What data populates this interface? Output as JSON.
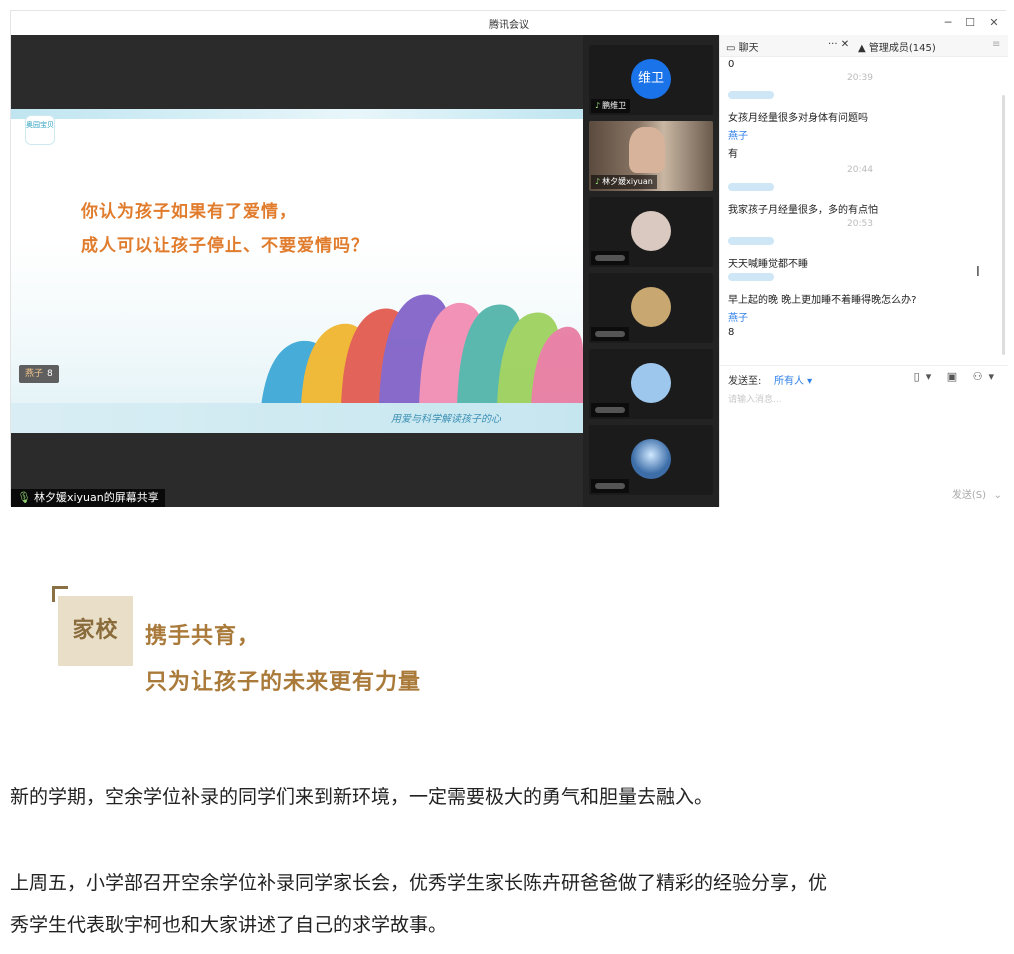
{
  "window": {
    "title": "腾讯会议",
    "controls": {
      "minimize": "─",
      "maximize": "☐",
      "close": "✕"
    }
  },
  "slide": {
    "logo_text": "奥园宝贝",
    "question_line1": "你认为孩子如果有了爱情，",
    "question_line2": "成人可以让孩子停止、不要爱情吗？",
    "chip_name": "燕子",
    "chip_value": "8",
    "bottom_tag": "用爱与科学解读孩子的心"
  },
  "share_label": "林夕媛xiyuan的屏幕共享",
  "participants": [
    {
      "name": "鹏维卫",
      "avatar_text": "维卫",
      "avatar_color": "#1a73e8"
    },
    {
      "name": "林夕媛xiyuan",
      "avatar_text": "",
      "avatar_color": "#7b6a5a"
    },
    {
      "name": "",
      "avatar_text": "",
      "avatar_color": "#d9c9c0"
    },
    {
      "name": "",
      "avatar_text": "",
      "avatar_color": "#c8a770"
    },
    {
      "name": "",
      "avatar_text": "",
      "avatar_color": "#9ec7ee"
    },
    {
      "name": "",
      "avatar_text": "",
      "avatar_color": "#3d6ea8"
    }
  ],
  "chat": {
    "tab_chat": "聊天",
    "tab_members": "管理成员(145)",
    "messages": [
      {
        "text": "0"
      },
      {
        "time": "20:39"
      },
      {
        "text": "女孩月经量很多对身体有问题吗"
      },
      {
        "text": "燕子"
      },
      {
        "text": "有"
      },
      {
        "time": "20:44"
      },
      {
        "text": "我家孩子月经量很多，多的有点怕"
      },
      {
        "time": "20:53"
      },
      {
        "text": "天天喊睡觉都不睡"
      },
      {
        "text": "早上起的晚 晚上更加睡不着睡得晚怎么办?"
      },
      {
        "text": "燕子"
      },
      {
        "text": "8"
      }
    ],
    "send_to_label": "发送至:",
    "send_to_value": "所有人 ▾",
    "input_placeholder": "请输入消息...",
    "send_button": "发送(S)"
  },
  "article": {
    "tag": "家校",
    "heading_line1": "携手共育，",
    "heading_line2": "只为让孩子的未来更有力量",
    "para1": "新的学期，空余学位补录的同学们来到新环境，一定需要极大的勇气和胆量去融入。",
    "para2_line1": "上周五，小学部召开空余学位补录同学家长会，优秀学生家长陈卉研爸爸做了精彩的经验分享，优",
    "para2_line2": "秀学生代表耿宇柯也和大家讲述了自己的求学故事。"
  }
}
